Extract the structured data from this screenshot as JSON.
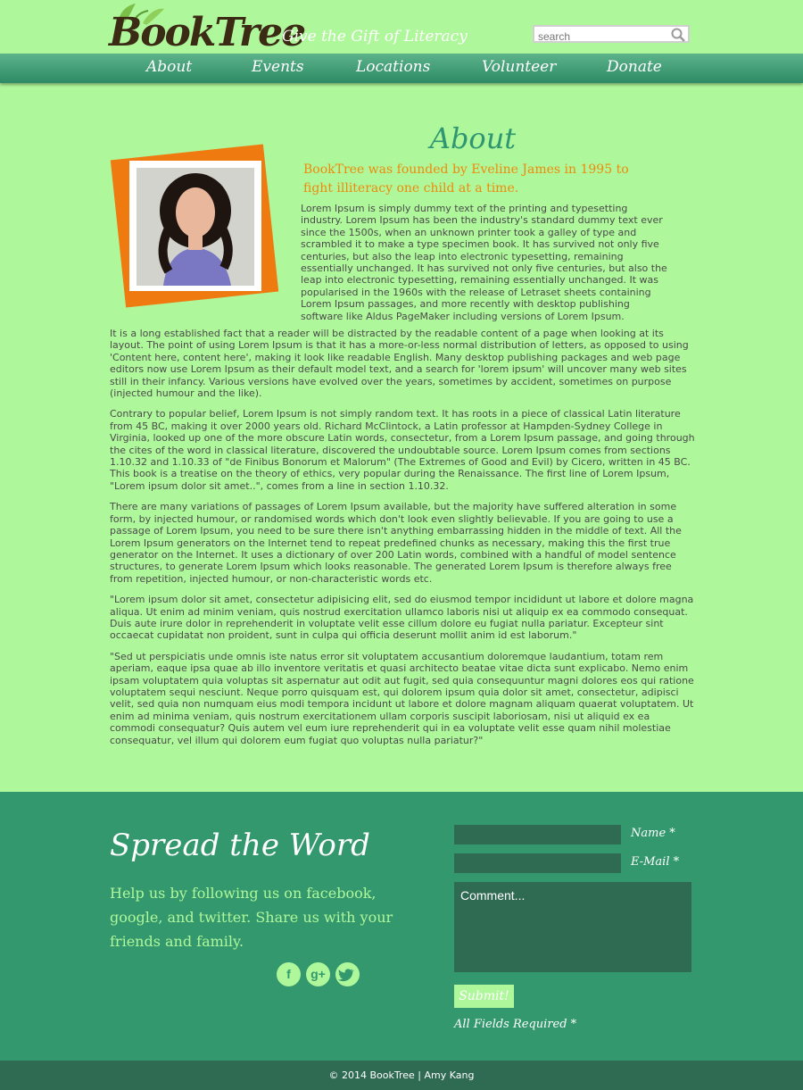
{
  "header": {
    "logo_text": "BookTree",
    "tagline": "Give the Gift of Literacy",
    "search_placeholder": "search"
  },
  "nav": {
    "items": [
      {
        "label": "About"
      },
      {
        "label": "Events"
      },
      {
        "label": "Locations"
      },
      {
        "label": "Volunteer"
      },
      {
        "label": "Donate"
      }
    ]
  },
  "about": {
    "title": "About",
    "lead": "BookTree was founded by Eveline James in 1995 to fight illiteracy one child at a time.",
    "photo_alt": "portrait-photo",
    "paragraphs": [
      "Lorem Ipsum is simply dummy text of the printing and typesetting industry. Lorem Ipsum has been the industry's standard dummy text ever since the 1500s, when an unknown printer took a galley of type and scrambled it to make a type specimen book. It has survived not only five centuries, but also the leap into electronic typesetting, remaining essentially unchanged. It has survived not only five centuries, but also the leap into electronic typesetting, remaining essentially unchanged. It was popularised in the 1960s with the release of Letraset sheets containing Lorem Ipsum passages, and more recently with desktop publishing software like Aldus PageMaker including versions of Lorem Ipsum.",
      "It is a long established fact that a reader will be distracted by the readable content of a page when looking at its layout. The point of using Lorem Ipsum is that it has a more-or-less normal distribution of letters, as opposed to using 'Content here, content here', making it look like readable English. Many desktop publishing packages and web page editors now use Lorem Ipsum as their default model text, and a search for 'lorem ipsum' will uncover many web sites still in their infancy. Various versions have evolved over the years, sometimes by accident, sometimes on purpose (injected humour and the like).",
      "Contrary to popular belief, Lorem Ipsum is not simply random text. It has roots in a piece of classical Latin literature from 45 BC, making it over 2000 years old. Richard McClintock, a Latin professor at Hampden-Sydney College in Virginia, looked up one of the more obscure Latin words, consectetur, from a Lorem Ipsum passage, and going through the cites of the word in classical literature, discovered the undoubtable source. Lorem Ipsum comes from sections 1.10.32 and 1.10.33 of \"de Finibus Bonorum et Malorum\" (The Extremes of Good and Evil) by Cicero, written in 45 BC. This book is a treatise on the theory of ethics, very popular during the Renaissance. The first line of Lorem Ipsum, \"Lorem ipsum dolor sit amet..\", comes from a line in section 1.10.32.",
      "There are many variations of passages of Lorem Ipsum available, but the majority have suffered alteration in some form, by injected humour, or randomised words which don't look even slightly believable. If you are going to use a passage of Lorem Ipsum, you need to be sure there isn't anything embarrassing hidden in the middle of text. All the Lorem Ipsum generators on the Internet tend to repeat predefined chunks as necessary, making this the first true generator on the Internet. It uses a dictionary of over 200 Latin words, combined with a handful of model sentence structures, to generate Lorem Ipsum which looks reasonable. The generated Lorem Ipsum is therefore always free from repetition, injected humour, or non-characteristic words etc.",
      "\"Lorem ipsum dolor sit amet, consectetur adipisicing elit, sed do eiusmod tempor incididunt ut labore et dolore magna aliqua. Ut enim ad minim veniam, quis nostrud exercitation ullamco laboris nisi ut aliquip ex ea commodo consequat. Duis aute irure dolor in reprehenderit in voluptate velit esse cillum dolore eu fugiat nulla pariatur. Excepteur sint occaecat cupidatat non proident, sunt in culpa qui officia deserunt mollit anim id est laborum.\"",
      "\"Sed ut perspiciatis unde omnis iste natus error sit voluptatem accusantium doloremque laudantium, totam rem aperiam, eaque ipsa quae ab illo inventore veritatis et quasi architecto beatae vitae dicta sunt explicabo. Nemo enim ipsam voluptatem quia voluptas sit aspernatur aut odit aut fugit, sed quia consequuntur magni dolores eos qui ratione voluptatem sequi nesciunt. Neque porro quisquam est, qui dolorem ipsum quia dolor sit amet, consectetur, adipisci velit, sed quia non numquam eius modi tempora incidunt ut labore et dolore magnam aliquam quaerat voluptatem. Ut enim ad minima veniam, quis nostrum exercitationem ullam corporis suscipit laboriosam, nisi ut aliquid ex ea commodi consequatur? Quis autem vel eum iure reprehenderit qui in ea voluptate velit esse quam nihil molestiae consequatur, vel illum qui dolorem eum fugiat quo voluptas nulla pariatur?\""
    ]
  },
  "footer": {
    "spread_title": "Spread the Word",
    "spread_text": "Help us by following us on facebook, google, and twitter. Share us with your friends and family.",
    "social": [
      {
        "icon": "facebook-icon",
        "glyph": "f"
      },
      {
        "icon": "google-plus-icon",
        "glyph": "g+"
      },
      {
        "icon": "twitter-icon",
        "glyph": "t"
      }
    ],
    "form": {
      "name_label": "Name *",
      "email_label": "E-Mail *",
      "comment_placeholder": "Comment...",
      "submit_label": "Submit!",
      "required_note": "All Fields Required *"
    },
    "copyright": "© 2014 BookTree | Amy Kang"
  },
  "colors": {
    "page_bg": "#aff79b",
    "nav": "#2d8a64",
    "accent_orange": "#ef7a0f",
    "footer_bg": "#33986d",
    "footer_dark": "#2f6a52",
    "title_green": "#2e9670"
  }
}
